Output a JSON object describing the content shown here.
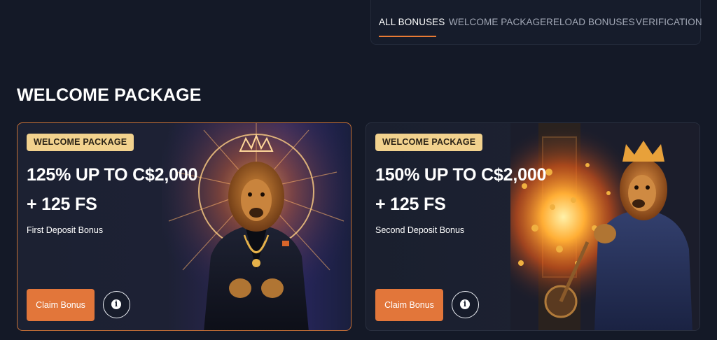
{
  "tabs": [
    {
      "label": "ALL BONUSES",
      "active": true
    },
    {
      "label": "WELCOME PACKAGE",
      "active": false
    },
    {
      "label": "RELOAD BONUSES",
      "active": false
    },
    {
      "label": "VERIFICATION",
      "active": false
    }
  ],
  "section": {
    "title": "WELCOME PACKAGE"
  },
  "cards": [
    {
      "badge": "WELCOME PACKAGE",
      "offer_line1": "125% UP TO C$2,000",
      "offer_line2": "+ 125 FS",
      "subtitle": "First Deposit Bonus",
      "claim_label": "Claim Bonus",
      "info_icon": "info-icon",
      "image": "lion-in-suit-with-halo"
    },
    {
      "badge": "WELCOME PACKAGE",
      "offer_line1": "150% UP TO C$2,000",
      "offer_line2": "+ 125 FS",
      "subtitle": "Second Deposit Bonus",
      "claim_label": "Claim Bonus",
      "info_icon": "info-icon",
      "image": "lion-with-crown-at-slot-machine"
    }
  ],
  "colors": {
    "background": "#141927",
    "accent": "#e2763a",
    "badge": "#f2d28e",
    "active_card_border": "#c46f36"
  }
}
